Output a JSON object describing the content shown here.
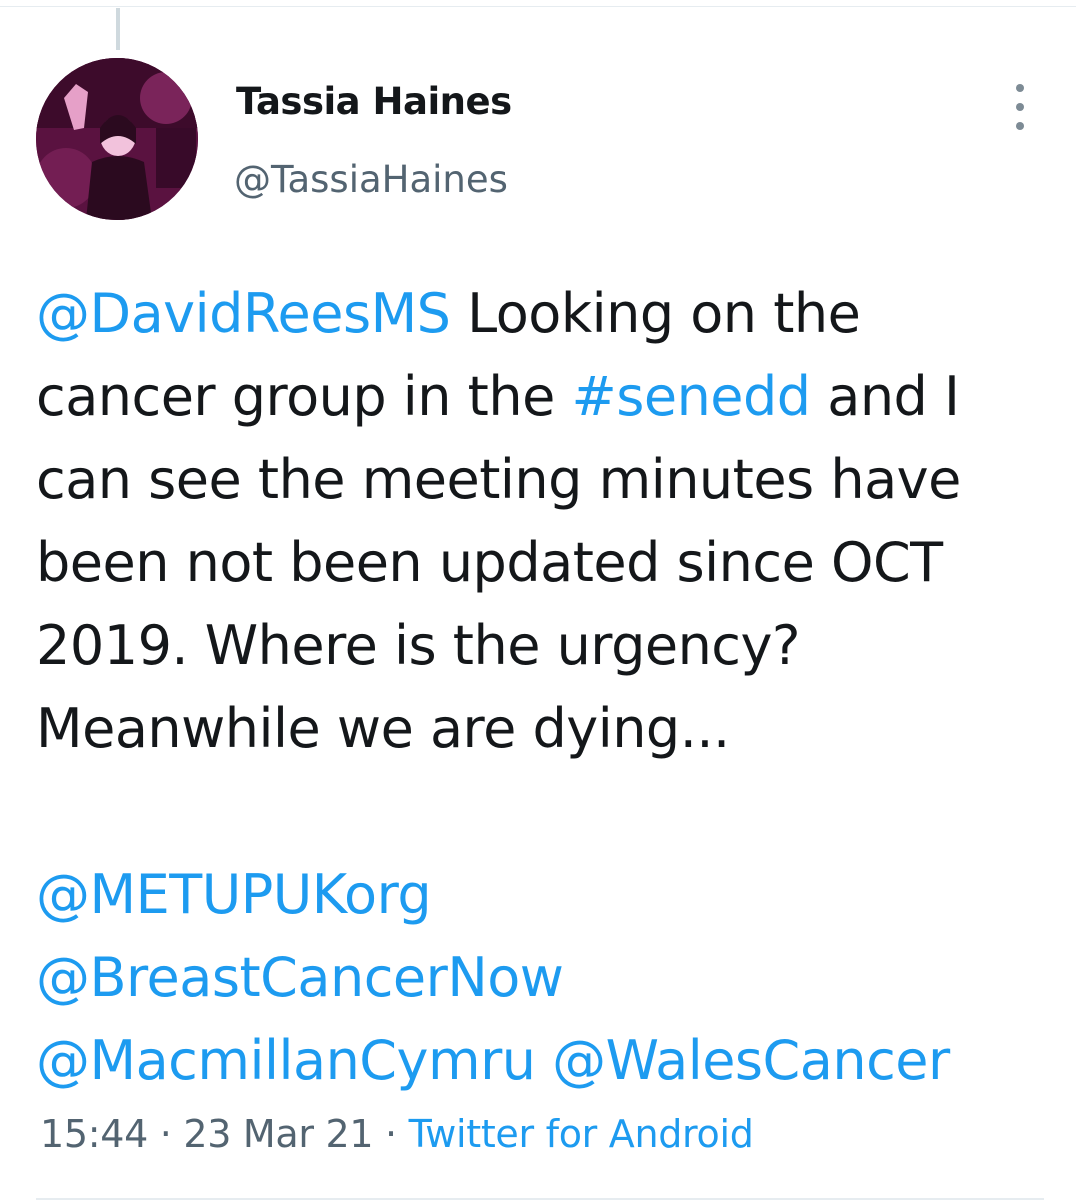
{
  "author": {
    "display_name": "Tassia Haines",
    "handle": "@TassiaHaines",
    "avatar_icon": "user-photo-avatar"
  },
  "tweet": {
    "line1": {
      "mention": "@DavidReesMS",
      "text": " Looking on the"
    },
    "line2": {
      "text": "cancer group in the ",
      "hashtag": "#senedd",
      "text_after": " and I"
    },
    "line3": "can see the meeting minutes have",
    "line4": "been not been updated since OCT",
    "line5": "2019. Where is the urgency?",
    "line6": "Meanwhile we are dying...",
    "mentions": {
      "metupuk": "@METUPUKorg",
      "breastcancernow": "@BreastCancerNow",
      "macmillan": "@MacmillanCymru",
      "walescancer": "@WalesCancer"
    }
  },
  "meta": {
    "time": "15:44",
    "separator": " · ",
    "date": "23 Mar 21",
    "source": "Twitter for Android"
  },
  "colors": {
    "link": "#1d9bf0",
    "text": "#14171a",
    "secondary": "#536471"
  }
}
